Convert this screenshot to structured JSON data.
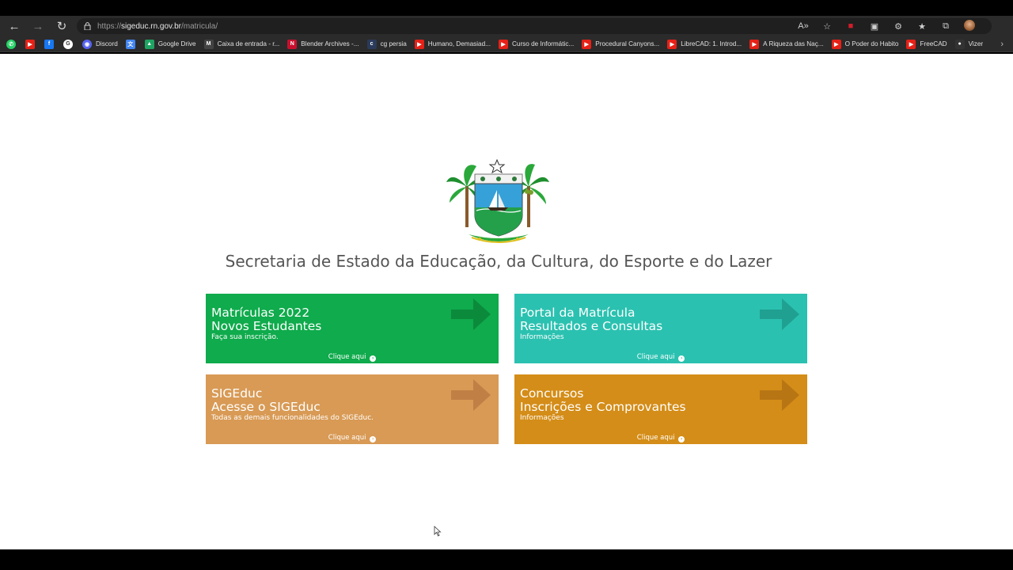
{
  "browser": {
    "url_prefix": "https://",
    "url_host": "sigeduc.rn.gov.br",
    "url_path": "/matricula/",
    "nav": {
      "back": "←",
      "forward": "→",
      "reload": "↻"
    },
    "bookmarks": [
      {
        "label": "",
        "icon": "whatsapp-icon",
        "color": "#25d366",
        "glyph": "✆"
      },
      {
        "label": "",
        "icon": "youtube-icon",
        "color": "#e62117",
        "glyph": "▶"
      },
      {
        "label": "",
        "icon": "facebook-icon",
        "color": "#1877f2",
        "glyph": "f"
      },
      {
        "label": "",
        "icon": "google-icon",
        "color": "#ffffff",
        "glyph": "G"
      },
      {
        "label": "Discord",
        "icon": "discord-icon",
        "color": "#5865f2",
        "glyph": "◉"
      },
      {
        "label": "",
        "icon": "translate-icon",
        "color": "#4285f4",
        "glyph": "文"
      },
      {
        "label": "Google Drive",
        "icon": "drive-icon",
        "color": "#1fa463",
        "glyph": "▲"
      },
      {
        "label": "Caixa de entrada - r...",
        "icon": "gmail-icon",
        "color": "#444",
        "glyph": "M"
      },
      {
        "label": "Blender Archives -...",
        "icon": "blender-icon",
        "color": "#c8102e",
        "glyph": "N"
      },
      {
        "label": "cg persia",
        "icon": "cg-icon",
        "color": "#2a3a5a",
        "glyph": "c"
      },
      {
        "label": "Humano, Demasiad...",
        "icon": "youtube-icon",
        "color": "#e62117",
        "glyph": "▶"
      },
      {
        "label": "Curso de Informátic...",
        "icon": "youtube-icon",
        "color": "#e62117",
        "glyph": "▶"
      },
      {
        "label": "Procedural Canyons...",
        "icon": "youtube-icon",
        "color": "#e62117",
        "glyph": "▶"
      },
      {
        "label": "LibreCAD: 1. Introd...",
        "icon": "youtube-icon",
        "color": "#e62117",
        "glyph": "▶"
      },
      {
        "label": "A Riqueza das Naç...",
        "icon": "youtube-icon",
        "color": "#e62117",
        "glyph": "▶"
      },
      {
        "label": "O Poder do Habito",
        "icon": "youtube-icon",
        "color": "#e62117",
        "glyph": "▶"
      },
      {
        "label": "FreeCAD",
        "icon": "youtube-icon",
        "color": "#e62117",
        "glyph": "▶"
      },
      {
        "label": "Vizer",
        "icon": "vizer-icon",
        "color": "#333",
        "glyph": "●"
      }
    ],
    "more": "›"
  },
  "page": {
    "title": "Secretaria de Estado da Educação, da Cultura, do Esporte e do Lazer",
    "cards": [
      {
        "line1": "Matrículas 2022",
        "line2": "Novos Estudantes",
        "sub": "Faça sua inscrição.",
        "cta": "Clique aqui",
        "color": "#0fab4c",
        "arrow_color": "#0b8a3c"
      },
      {
        "line1": "Portal da Matrícula",
        "line2": "Resultados e Consultas",
        "sub": "Informações",
        "cta": "Clique aqui",
        "color": "#2bc1b0",
        "arrow_color": "#1fa091"
      },
      {
        "line1": "SIGEduc",
        "line2": "Acesse o SIGEduc",
        "sub": "Todas as demais funcionalidades do SIGEduc.",
        "cta": "Clique aqui",
        "color": "#d89a55",
        "arrow_color": "#c08045"
      },
      {
        "line1": "Concursos",
        "line2": "Inscrições e Comprovantes",
        "sub": "Informações",
        "cta": "Clique aqui",
        "color": "#d48d18",
        "arrow_color": "#b87514"
      }
    ]
  }
}
